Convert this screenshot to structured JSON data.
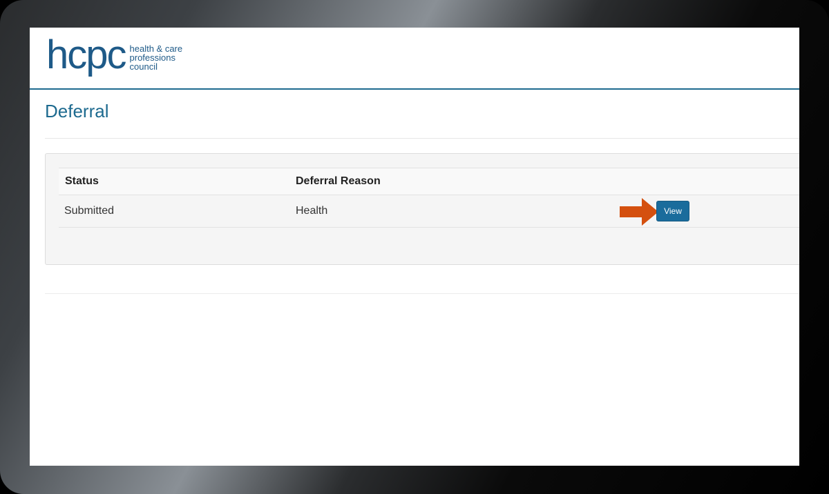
{
  "logo": {
    "wordmark": "hcpc",
    "tagline_1": "health & care",
    "tagline_2": "professions",
    "tagline_3": "council"
  },
  "page": {
    "title": "Deferral"
  },
  "table": {
    "headers": [
      "Status",
      "Deferral Reason"
    ],
    "rows": [
      {
        "status": "Submitted",
        "reason": "Health",
        "action": "View"
      }
    ]
  },
  "colors": {
    "brand": "#1e5a88",
    "button": "#1a6c9c",
    "annotation_arrow": "#d4500f"
  },
  "icons": {
    "annotation": "arrow-right-icon"
  }
}
